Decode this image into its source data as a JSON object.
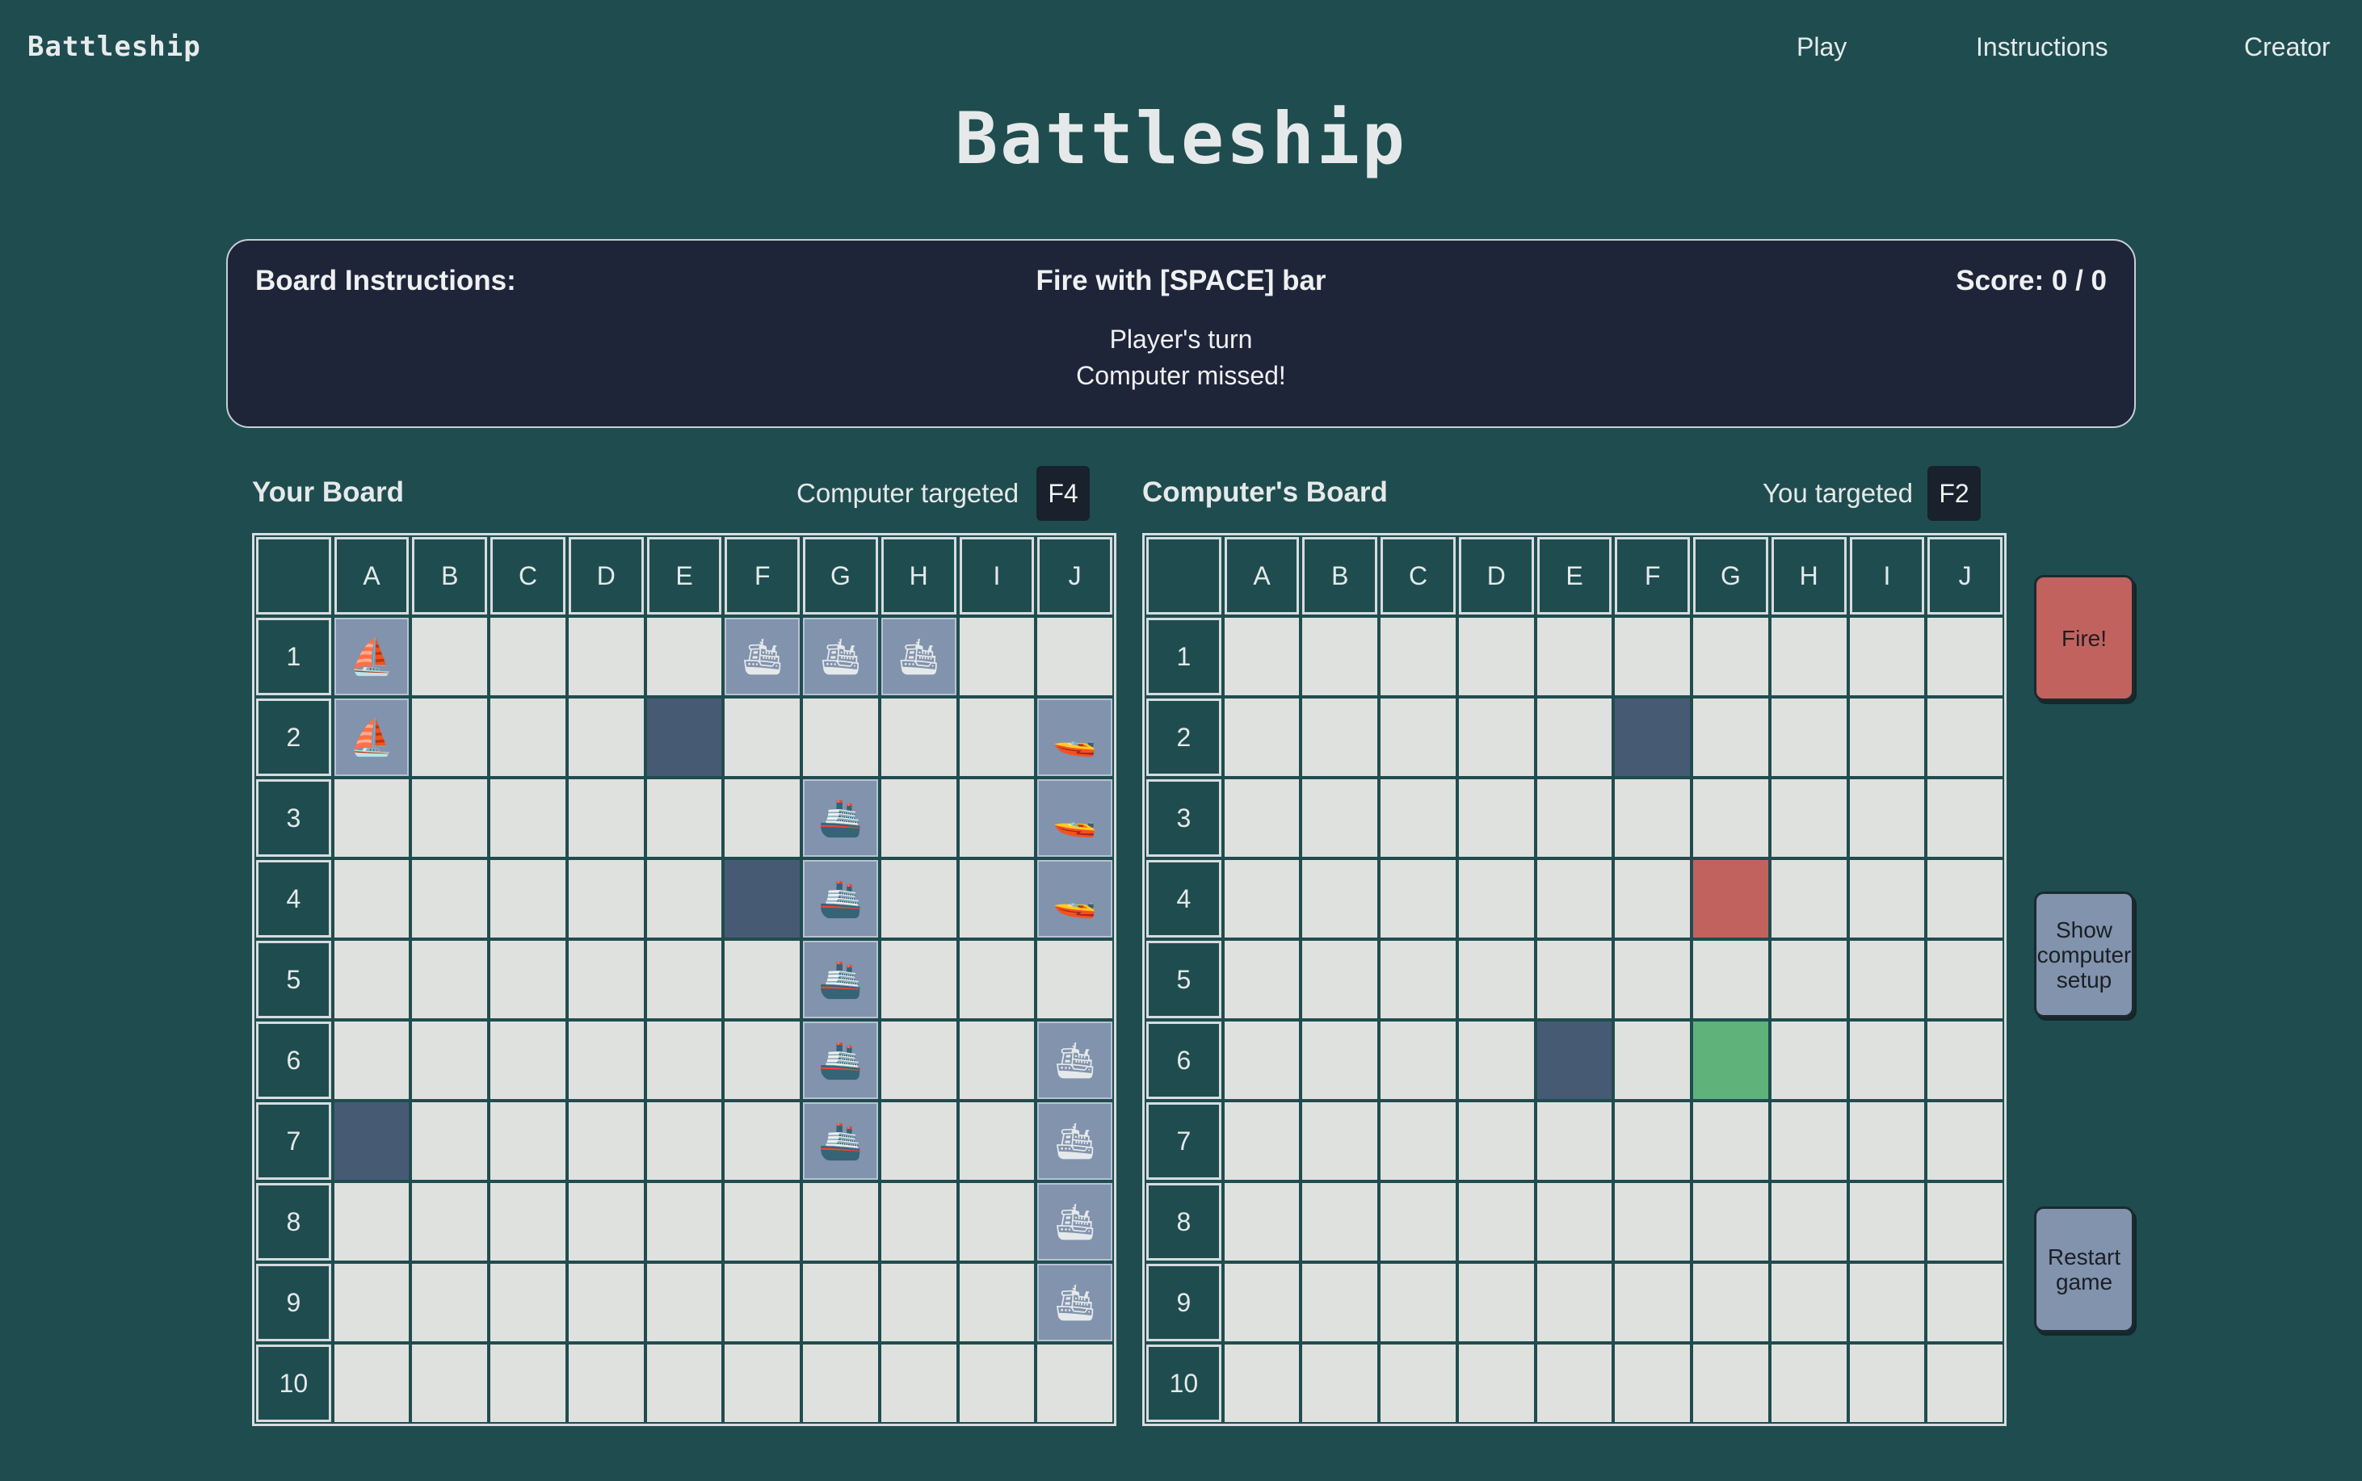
{
  "nav": {
    "logo": "Battleship",
    "links": [
      "Play",
      "Instructions",
      "Creator"
    ]
  },
  "title": "Battleship",
  "panel": {
    "heading": "Board Instructions:",
    "fire_hint": "Fire with [SPACE] bar",
    "score": "Score: 0 / 0",
    "turn": "Player's turn",
    "last_event": "Computer missed!"
  },
  "colors": {
    "background": "#1f4d4f",
    "panel": "#1e2538",
    "empty_cell": "#dfe1de",
    "ship_cell": "#8193ad",
    "miss_cell": "#475a74",
    "hit_cell": "#c2625e",
    "current_target": "#5fb37a"
  },
  "columns": [
    "A",
    "B",
    "C",
    "D",
    "E",
    "F",
    "G",
    "H",
    "I",
    "J"
  ],
  "rows": [
    "1",
    "2",
    "3",
    "4",
    "5",
    "6",
    "7",
    "8",
    "9",
    "10"
  ],
  "player_board": {
    "title": "Your Board",
    "target_label": "Computer targeted",
    "target": "F4",
    "ships": [
      {
        "cell": "A1",
        "icon": "⛵"
      },
      {
        "cell": "A2",
        "icon": "⛵"
      },
      {
        "cell": "F1",
        "icon": "🛳"
      },
      {
        "cell": "G1",
        "icon": "🛳"
      },
      {
        "cell": "H1",
        "icon": "🛳"
      },
      {
        "cell": "J2",
        "icon": "🚤"
      },
      {
        "cell": "J3",
        "icon": "🚤"
      },
      {
        "cell": "J4",
        "icon": "🚤"
      },
      {
        "cell": "G3",
        "icon": "🚢"
      },
      {
        "cell": "G4",
        "icon": "🚢"
      },
      {
        "cell": "G5",
        "icon": "🚢"
      },
      {
        "cell": "G6",
        "icon": "🚢"
      },
      {
        "cell": "G7",
        "icon": "🚢"
      },
      {
        "cell": "J6",
        "icon": "🛳"
      },
      {
        "cell": "J7",
        "icon": "🛳"
      },
      {
        "cell": "J8",
        "icon": "🛳"
      },
      {
        "cell": "J9",
        "icon": "🛳"
      }
    ],
    "misses": [
      "E2",
      "F4",
      "A7"
    ],
    "hits": [],
    "current": ""
  },
  "computer_board": {
    "title": "Computer's Board",
    "target_label": "You targeted",
    "target": "F2",
    "ships": [],
    "misses": [
      "F2",
      "E6"
    ],
    "hits": [
      "G4"
    ],
    "current": "G6"
  },
  "buttons": {
    "fire": "Fire!",
    "show_setup": "Show computer setup",
    "restart": "Restart game"
  }
}
